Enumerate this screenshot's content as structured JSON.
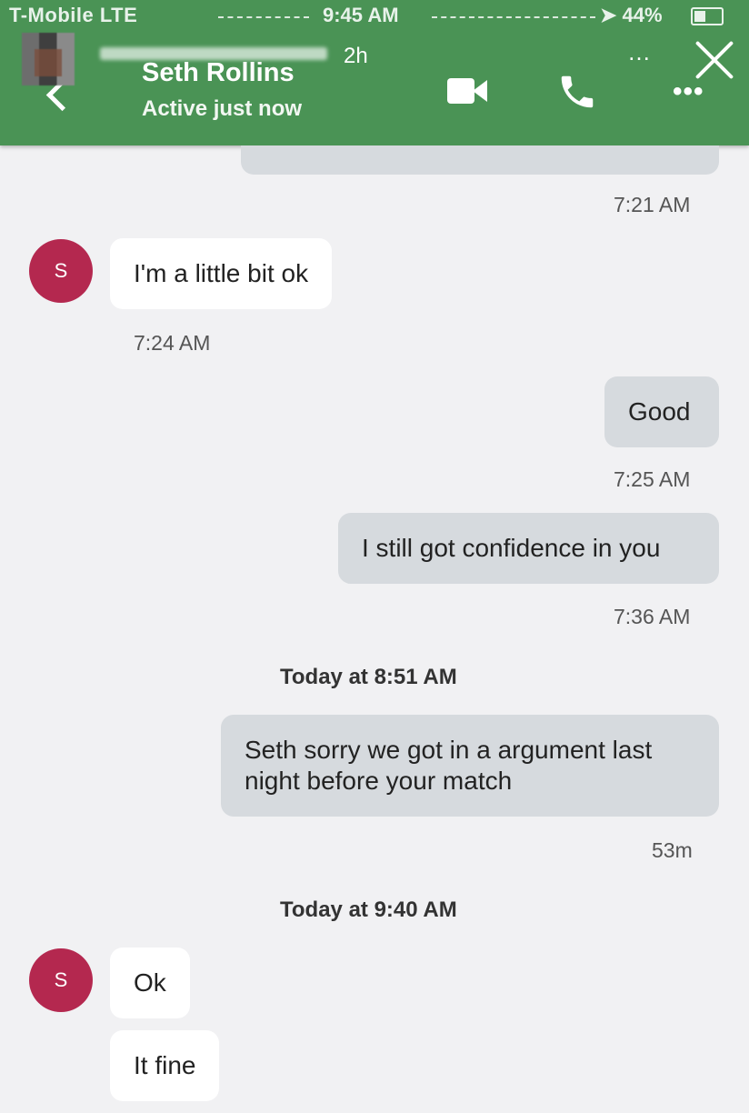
{
  "status_bar": {
    "carrier": "T-Mobile  LTE",
    "time": "9:45 AM",
    "battery": "44%"
  },
  "story": {
    "age": "2h",
    "more": "…"
  },
  "header": {
    "contact_name": "Seth Rollins",
    "status": "Active just now",
    "more": "•••"
  },
  "avatar_initial": "S",
  "messages": [
    {
      "direction": "out",
      "text": "",
      "time": "7:21 AM"
    },
    {
      "direction": "in",
      "text": "I'm a little bit ok",
      "time": "7:24 AM"
    },
    {
      "direction": "out",
      "text": "Good",
      "time": "7:25 AM"
    },
    {
      "direction": "out",
      "text": "I still got confidence in you",
      "time": "7:36 AM"
    },
    {
      "direction": "divider",
      "text": "Today at 8:51 AM"
    },
    {
      "direction": "out",
      "text": "Seth sorry we got in a argument last night before your match",
      "time": "53m"
    },
    {
      "direction": "divider",
      "text": "Today at 9:40 AM"
    },
    {
      "direction": "in",
      "text": "Ok"
    },
    {
      "direction": "in",
      "text": "It fine"
    }
  ],
  "colors": {
    "header": "#4a9355",
    "avatar": "#b4284f",
    "outgoing_bubble": "#d6dade",
    "incoming_bubble": "#ffffff",
    "background": "#f1f1f3"
  }
}
